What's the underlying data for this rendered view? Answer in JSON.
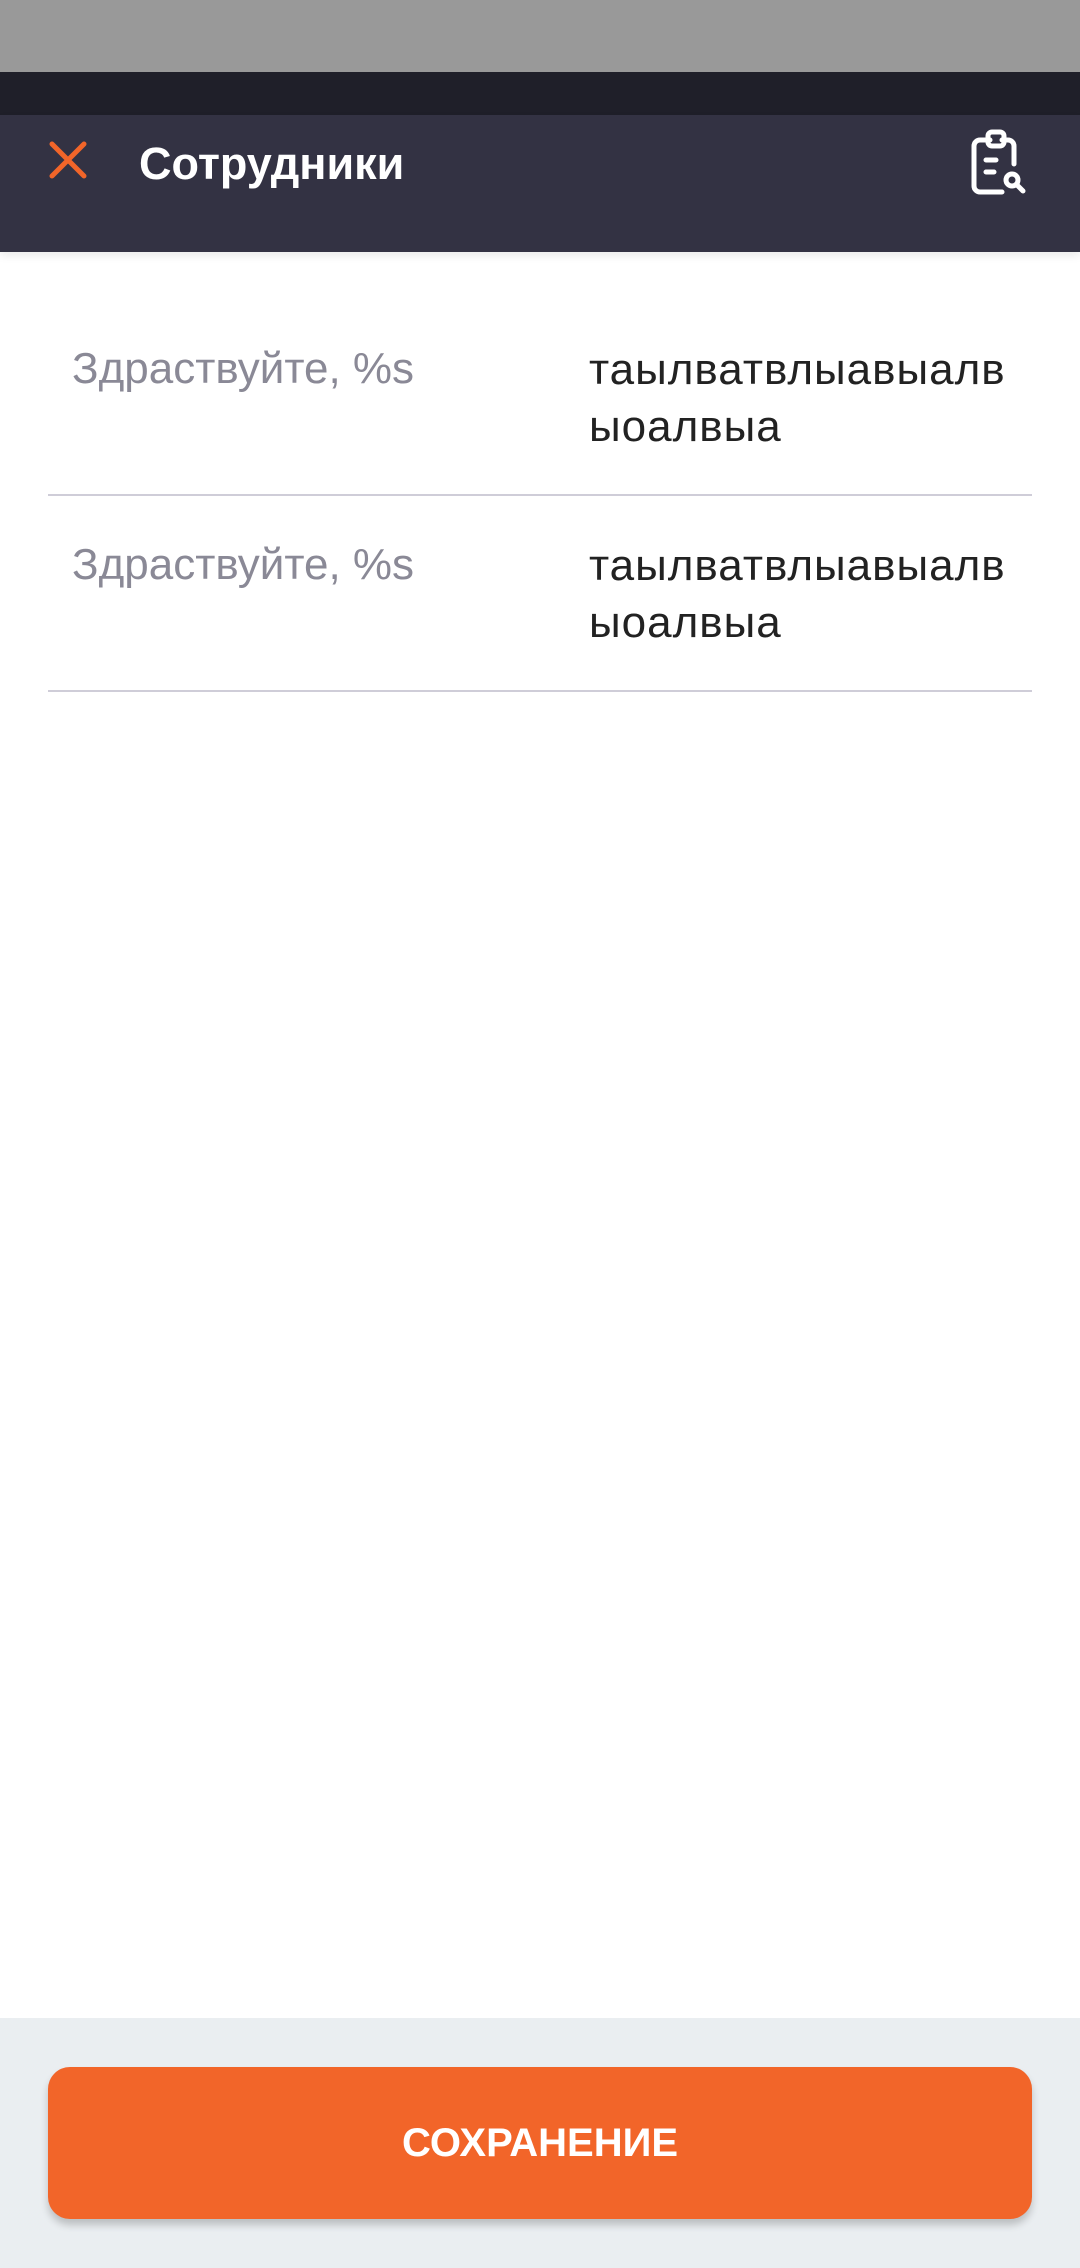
{
  "header": {
    "title": "Сотрудники"
  },
  "rows": [
    {
      "label": "Здраствуйте, %s",
      "value": "таылватвлыавыалвыоалвыа"
    },
    {
      "label": "Здраствуйте, %s",
      "value": "таылватвлыавыалвыоалвыа"
    }
  ],
  "footer": {
    "save_label": "СОХРАНЕНИЕ"
  },
  "colors": {
    "accent": "#f26529",
    "toolbar": "#333243"
  }
}
